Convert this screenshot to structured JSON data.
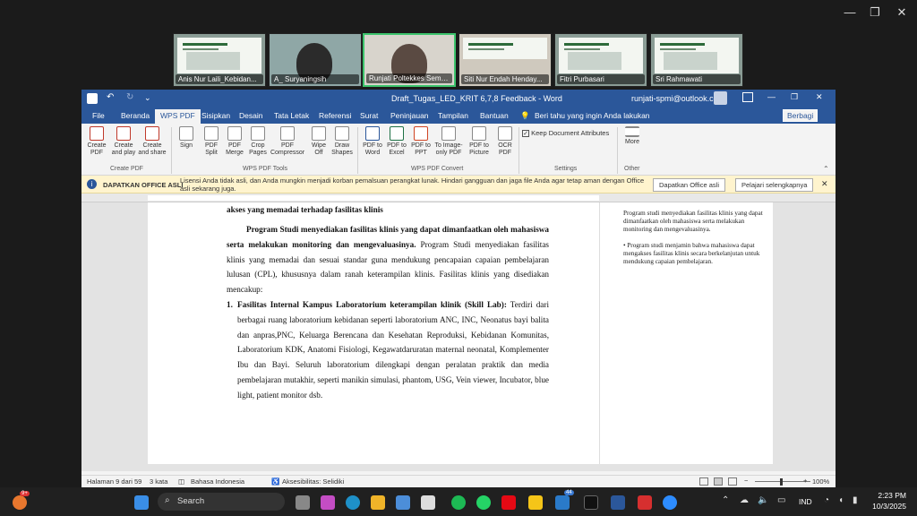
{
  "window_controls": {
    "minimize": "—",
    "maximize": "❐",
    "close": "✕"
  },
  "participants": [
    {
      "name": "Anis Nur Laili_Kebidan...",
      "kind": "slide"
    },
    {
      "name": "A_ Suryaningsih",
      "kind": "face"
    },
    {
      "name": "Runjati Poltekkes Semara...",
      "kind": "face",
      "active": true
    },
    {
      "name": "Siti Nur Endah Henday...",
      "kind": "slide"
    },
    {
      "name": "Fitri Purbasari",
      "kind": "slide"
    },
    {
      "name": "Sri Rahmawati",
      "kind": "slide"
    }
  ],
  "word": {
    "doc_title": "Draft_Tugas_LED_KRIT 6,7,8 Feedback  -  Word",
    "account": "runjati-spmi@outlook.com",
    "tabs": [
      "File",
      "Beranda",
      "WPS PDF",
      "Sisipkan",
      "Desain",
      "Tata Letak",
      "Referensi",
      "Surat",
      "Peninjauan",
      "Tampilan",
      "Bantuan"
    ],
    "selected_tab": "WPS PDF",
    "tell_me": "Beri tahu yang ingin Anda lakukan",
    "share": "Berbagi",
    "ribbon": {
      "create_pdf": [
        "Create PDF",
        "Create and play",
        "Create and share"
      ],
      "tools": [
        "Sign",
        "PDF Split",
        "PDF Merge",
        "Crop Pages",
        "PDF Compressor",
        "Wipe Off",
        "Draw Shapes"
      ],
      "convert": [
        "PDF to Word",
        "PDF to Excel",
        "PDF to PPT",
        "To Image-only PDF",
        "PDF to Picture",
        "OCR PDF"
      ],
      "keep_attributes": "Keep Document Attributes",
      "more": "More",
      "groups": [
        "Create PDF",
        "WPS PDF Tools",
        "WPS PDF Convert",
        "Settings",
        "Other"
      ]
    },
    "infobar": {
      "title": "DAPATKAN OFFICE ASLI",
      "message": "Lisensi Anda tidak asli, dan Anda mungkin menjadi korban pemalsuan perangkat lunak. Hindari gangguan dan jaga file Anda agar tetap aman dengan Office asli sekarang juga.",
      "btn1": "Dapatkan Office asli",
      "btn2": "Pelajari selengkapnya"
    },
    "document": {
      "heading": "akses yang memadai terhadap fasilitas klinis",
      "para1_bold": "Program Studi menyediakan fasilitas klinis yang dapat dimanfaatkan oleh mahasiswa serta melakukan monitoring dan mengevaluasinya.",
      "para1_rest": " Program Studi menyediakan fasilitas klinis yang memadai dan sesuai standar guna mendukung pencapaian capaian pembelajaran lulusan (CPL), khususnya dalam ranah keterampilan klinis. Fasilitas klinis yang disediakan mencakup:",
      "item1_num": "1.",
      "item1_bold": "Fasilitas Internal Kampus Laboratorium keterampilan klinik (Skill Lab):",
      "item1_text": " Terdiri dari berbagai ruang laboratorium kebidanan seperti laboratorium ANC, INC, Neonatus bayi balita dan anpras,PNC, Keluarga Berencana dan Kesehatan Reproduksi, Kebidanan Komunitas, Laboratorium KDK, Anatomi Fisiologi, Kegawatdaruratan maternal neonatal, Komplementer Ibu dan Bayi. Seluruh laboratorium dilengkapi dengan peralatan praktik dan media pembelajaran mutakhir, seperti manikin simulasi, phantom, USG, Vein viewer, Incubator, blue light, patient monitor dsb."
    },
    "comment": {
      "line1": "Program studi menyediakan fasilitas klinis yang dapat dimanfaatkan oleh mahasiswa serta melakukan monitoring dan mengevaluasinya.",
      "line2": "• Program studi menjamin bahwa mahasiswa dapat mengakses fasilitas klinis secara berkelanjutan untuk mendukung capaian pembelajaran."
    },
    "status": {
      "page": "Halaman 9 dari 59",
      "words": "3 kata",
      "lang": "Bahasa Indonesia",
      "access": "Aksesibilitas: Selidiki",
      "zoom": "100%"
    }
  },
  "taskbar": {
    "search": "Search",
    "lang": "IND",
    "time": "2:23 PM",
    "date": "10/3/2025",
    "badge": "44",
    "notif": "9+"
  }
}
